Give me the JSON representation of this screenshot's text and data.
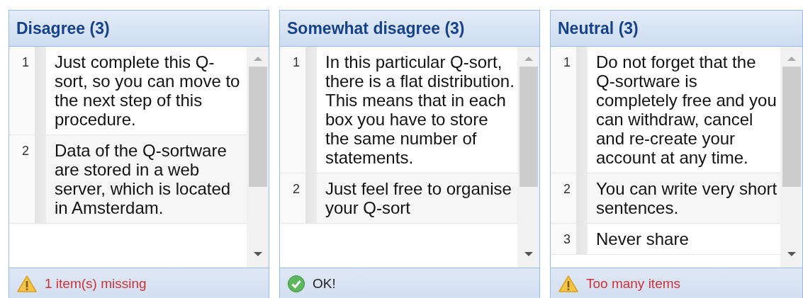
{
  "columns": [
    {
      "title": "Disagree (3)",
      "statements": [
        {
          "number": "1",
          "text": "Just complete this Q-sort, so you can move to the next step of this procedure."
        },
        {
          "number": "2",
          "text": "Data of the Q-sortware are stored in a web server, which is located in Amsterdam."
        }
      ],
      "status": {
        "kind": "warning",
        "text": "1 item(s) missing"
      }
    },
    {
      "title": "Somewhat disagree (3)",
      "statements": [
        {
          "number": "1",
          "text": "In this particular Q-sort, there is a flat distribution. This means that in each box you have to store the same number of statements."
        },
        {
          "number": "2",
          "text": "Just feel free to organise your Q-sort"
        }
      ],
      "status": {
        "kind": "ok",
        "text": "OK!"
      }
    },
    {
      "title": "Neutral (3)",
      "statements": [
        {
          "number": "1",
          "text": "Do not forget that the Q-sortware is completely free and you can withdraw, cancel and re-create your account at any time."
        },
        {
          "number": "2",
          "text": "You can write very short sentences."
        },
        {
          "number": "3",
          "text": "Never share"
        }
      ],
      "status": {
        "kind": "warning",
        "text": "Too many items"
      }
    }
  ]
}
